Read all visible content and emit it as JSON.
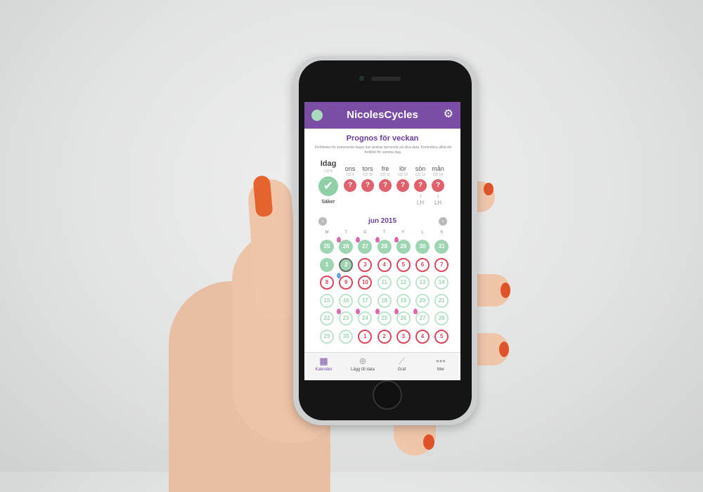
{
  "app": {
    "title": "NicolesCycles",
    "settings_icon": "gear-icon"
  },
  "forecast": {
    "title": "Prognos för veckan",
    "description": "Fertiliteten för kommande dagar kan ändras beroende på dina data. Kontrollera alltid din fertilitet för samma dag.",
    "today": {
      "label": "Idag",
      "cd": "CD 8",
      "status": "Säker"
    },
    "days": [
      {
        "label": "ons",
        "cd": "CD 9",
        "value": "?",
        "lh": ""
      },
      {
        "label": "tors",
        "cd": "CD 10",
        "value": "?",
        "lh": ""
      },
      {
        "label": "fre",
        "cd": "CD 11",
        "value": "?",
        "lh": ""
      },
      {
        "label": "lör",
        "cd": "CD 12",
        "value": "?",
        "lh": ""
      },
      {
        "label": "sön",
        "cd": "CD 13",
        "value": "?",
        "lh": "LH"
      },
      {
        "label": "mån",
        "cd": "CD 14",
        "value": "?",
        "lh": "LH"
      }
    ]
  },
  "calendar": {
    "month": "jun 2015",
    "weekdays": [
      "M",
      "T",
      "O",
      "T",
      "F",
      "L",
      "S"
    ],
    "weeks": [
      [
        {
          "d": "25",
          "s": "g"
        },
        {
          "d": "26",
          "s": "g",
          "drop": "p"
        },
        {
          "d": "27",
          "s": "g",
          "drop": "p"
        },
        {
          "d": "28",
          "s": "g",
          "drop": "p"
        },
        {
          "d": "29",
          "s": "g",
          "drop": "p"
        },
        {
          "d": "30",
          "s": "g"
        },
        {
          "d": "31",
          "s": "g"
        }
      ],
      [
        {
          "d": "1",
          "s": "g"
        },
        {
          "d": "2",
          "s": "sel"
        },
        {
          "d": "3",
          "s": "r"
        },
        {
          "d": "4",
          "s": "r"
        },
        {
          "d": "5",
          "s": "r"
        },
        {
          "d": "6",
          "s": "r"
        },
        {
          "d": "7",
          "s": "r"
        }
      ],
      [
        {
          "d": "8",
          "s": "r"
        },
        {
          "d": "9",
          "s": "r",
          "drop": "b"
        },
        {
          "d": "10",
          "s": "r"
        },
        {
          "d": "11",
          "s": "go"
        },
        {
          "d": "12",
          "s": "go"
        },
        {
          "d": "13",
          "s": "go"
        },
        {
          "d": "14",
          "s": "go"
        }
      ],
      [
        {
          "d": "15",
          "s": "go"
        },
        {
          "d": "16",
          "s": "go"
        },
        {
          "d": "17",
          "s": "go"
        },
        {
          "d": "18",
          "s": "go"
        },
        {
          "d": "19",
          "s": "go"
        },
        {
          "d": "20",
          "s": "go"
        },
        {
          "d": "21",
          "s": "go"
        }
      ],
      [
        {
          "d": "22",
          "s": "go"
        },
        {
          "d": "23",
          "s": "go",
          "drop": "p"
        },
        {
          "d": "24",
          "s": "go",
          "drop": "p"
        },
        {
          "d": "25",
          "s": "go",
          "drop": "p"
        },
        {
          "d": "26",
          "s": "go",
          "drop": "p"
        },
        {
          "d": "27",
          "s": "go",
          "drop": "p"
        },
        {
          "d": "28",
          "s": "go"
        }
      ],
      [
        {
          "d": "29",
          "s": "go"
        },
        {
          "d": "30",
          "s": "go"
        },
        {
          "d": "1",
          "s": "r"
        },
        {
          "d": "2",
          "s": "r"
        },
        {
          "d": "3",
          "s": "r"
        },
        {
          "d": "4",
          "s": "r"
        },
        {
          "d": "5",
          "s": "r"
        }
      ]
    ]
  },
  "nav": [
    {
      "label": "Kalender",
      "icon": "calendar-icon",
      "active": true
    },
    {
      "label": "Lägg till data",
      "icon": "plus-icon",
      "active": false
    },
    {
      "label": "Graf",
      "icon": "chart-icon",
      "active": false
    },
    {
      "label": "Mer",
      "icon": "more-icon",
      "active": false
    }
  ],
  "colors": {
    "primary": "#7a4ea5",
    "safe": "#9ed6b4",
    "fertile": "#d9485a",
    "period": "#d96ab0"
  }
}
